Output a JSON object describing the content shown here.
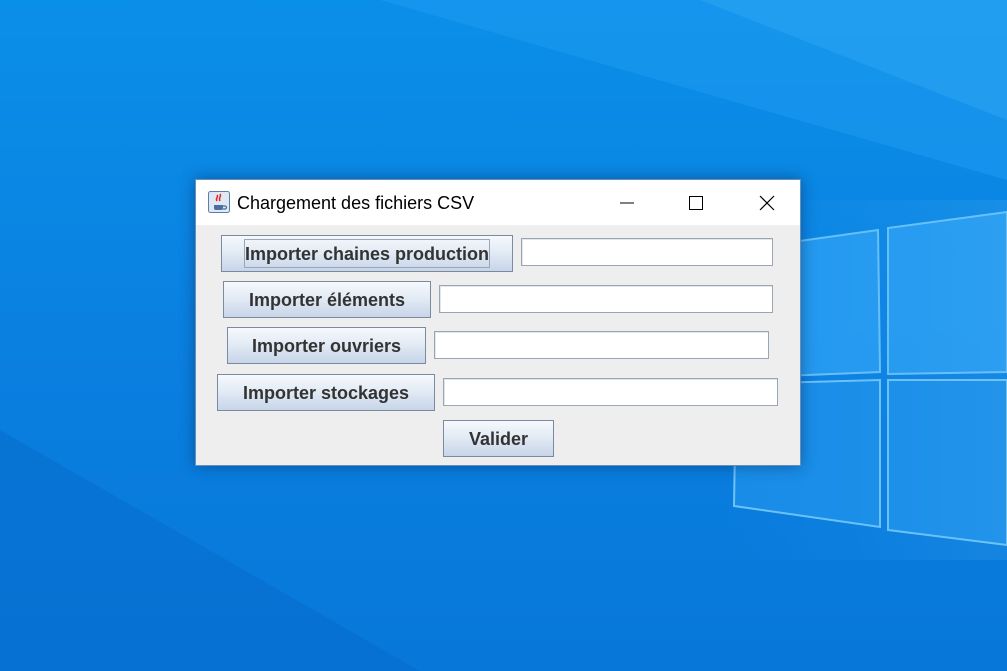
{
  "window": {
    "title": "Chargement des fichiers CSV",
    "icon": "java-cup-icon",
    "controls": [
      "minimize-icon",
      "maximize-icon",
      "close-icon"
    ]
  },
  "rows": [
    {
      "button_label": "Importer chaines production",
      "field_value": ""
    },
    {
      "button_label": "Importer éléments",
      "field_value": ""
    },
    {
      "button_label": "Importer ouvriers",
      "field_value": ""
    },
    {
      "button_label": "Importer stockages",
      "field_value": ""
    }
  ],
  "actions": {
    "validate_label": "Valider"
  },
  "colors": {
    "desktop_blue": "#0a7fe0",
    "window_bg": "#eeeeee",
    "button_gradient_top": "#f6f9fd",
    "button_gradient_bottom": "#c7d5e8"
  }
}
